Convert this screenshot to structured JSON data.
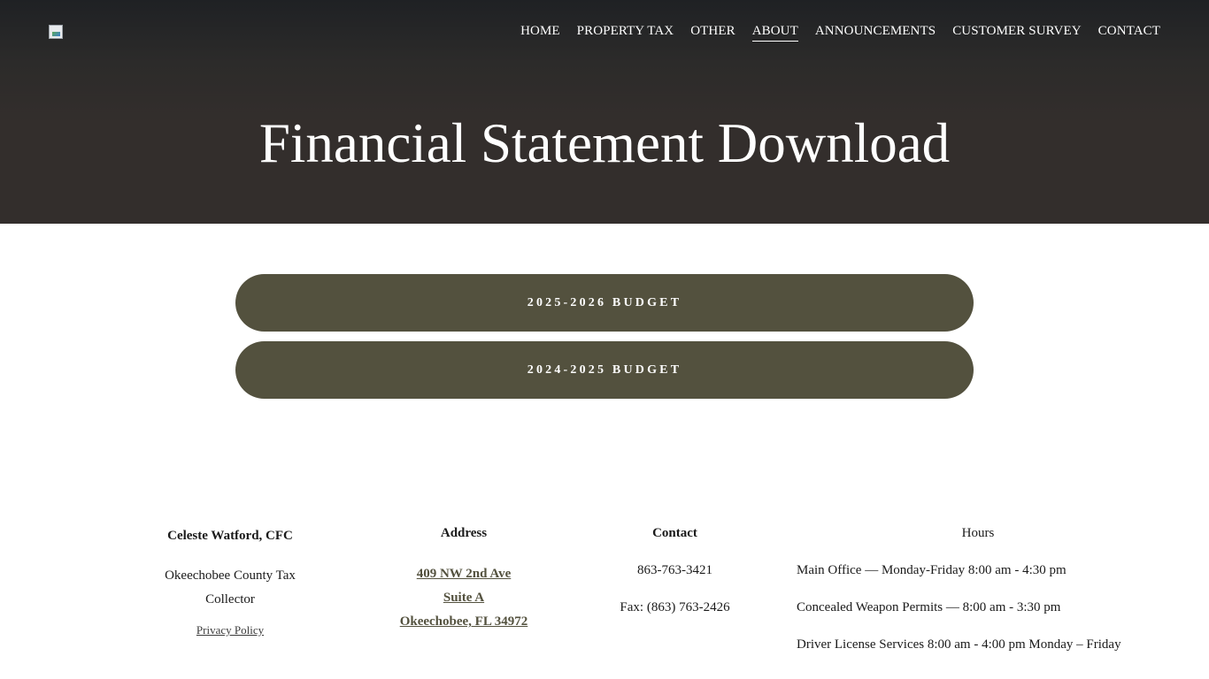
{
  "header": {
    "nav": [
      {
        "label": "HOME"
      },
      {
        "label": "PROPERTY TAX"
      },
      {
        "label": "OTHER"
      },
      {
        "label": "ABOUT",
        "active": true
      },
      {
        "label": "ANNOUNCEMENTS"
      },
      {
        "label": "CUSTOMER SURVEY"
      },
      {
        "label": "CONTACT"
      }
    ]
  },
  "hero": {
    "title": "Financial Statement Download"
  },
  "main": {
    "buttons": [
      {
        "label": "2025-2026 BUDGET"
      },
      {
        "label": "2024-2025 BUDGET"
      }
    ]
  },
  "footer": {
    "name": "Celeste Watford, CFC",
    "org": "Okeechobee County Tax Collector",
    "privacy": "Privacy Policy",
    "address_heading": "Address",
    "address_lines": [
      "409 NW 2nd Ave",
      "Suite A",
      "Okeechobee, FL 34972"
    ],
    "contact_heading": "Contact",
    "phone": "863-763-3421",
    "fax": "Fax: (863) 763-2426",
    "hours_heading": "Hours",
    "hours": [
      "Main Office — Monday-Friday 8:00 am - 4:30 pm",
      "Concealed Weapon Permits — 8:00 am - 3:30 pm",
      "Driver License Services 8:00 am - 4:00 pm Monday – Friday"
    ]
  },
  "colors": {
    "hero_bg": "#332e2c",
    "button_bg": "#53513e",
    "link": "#53513e"
  },
  "icons": {
    "logo": "broken-image-icon"
  }
}
